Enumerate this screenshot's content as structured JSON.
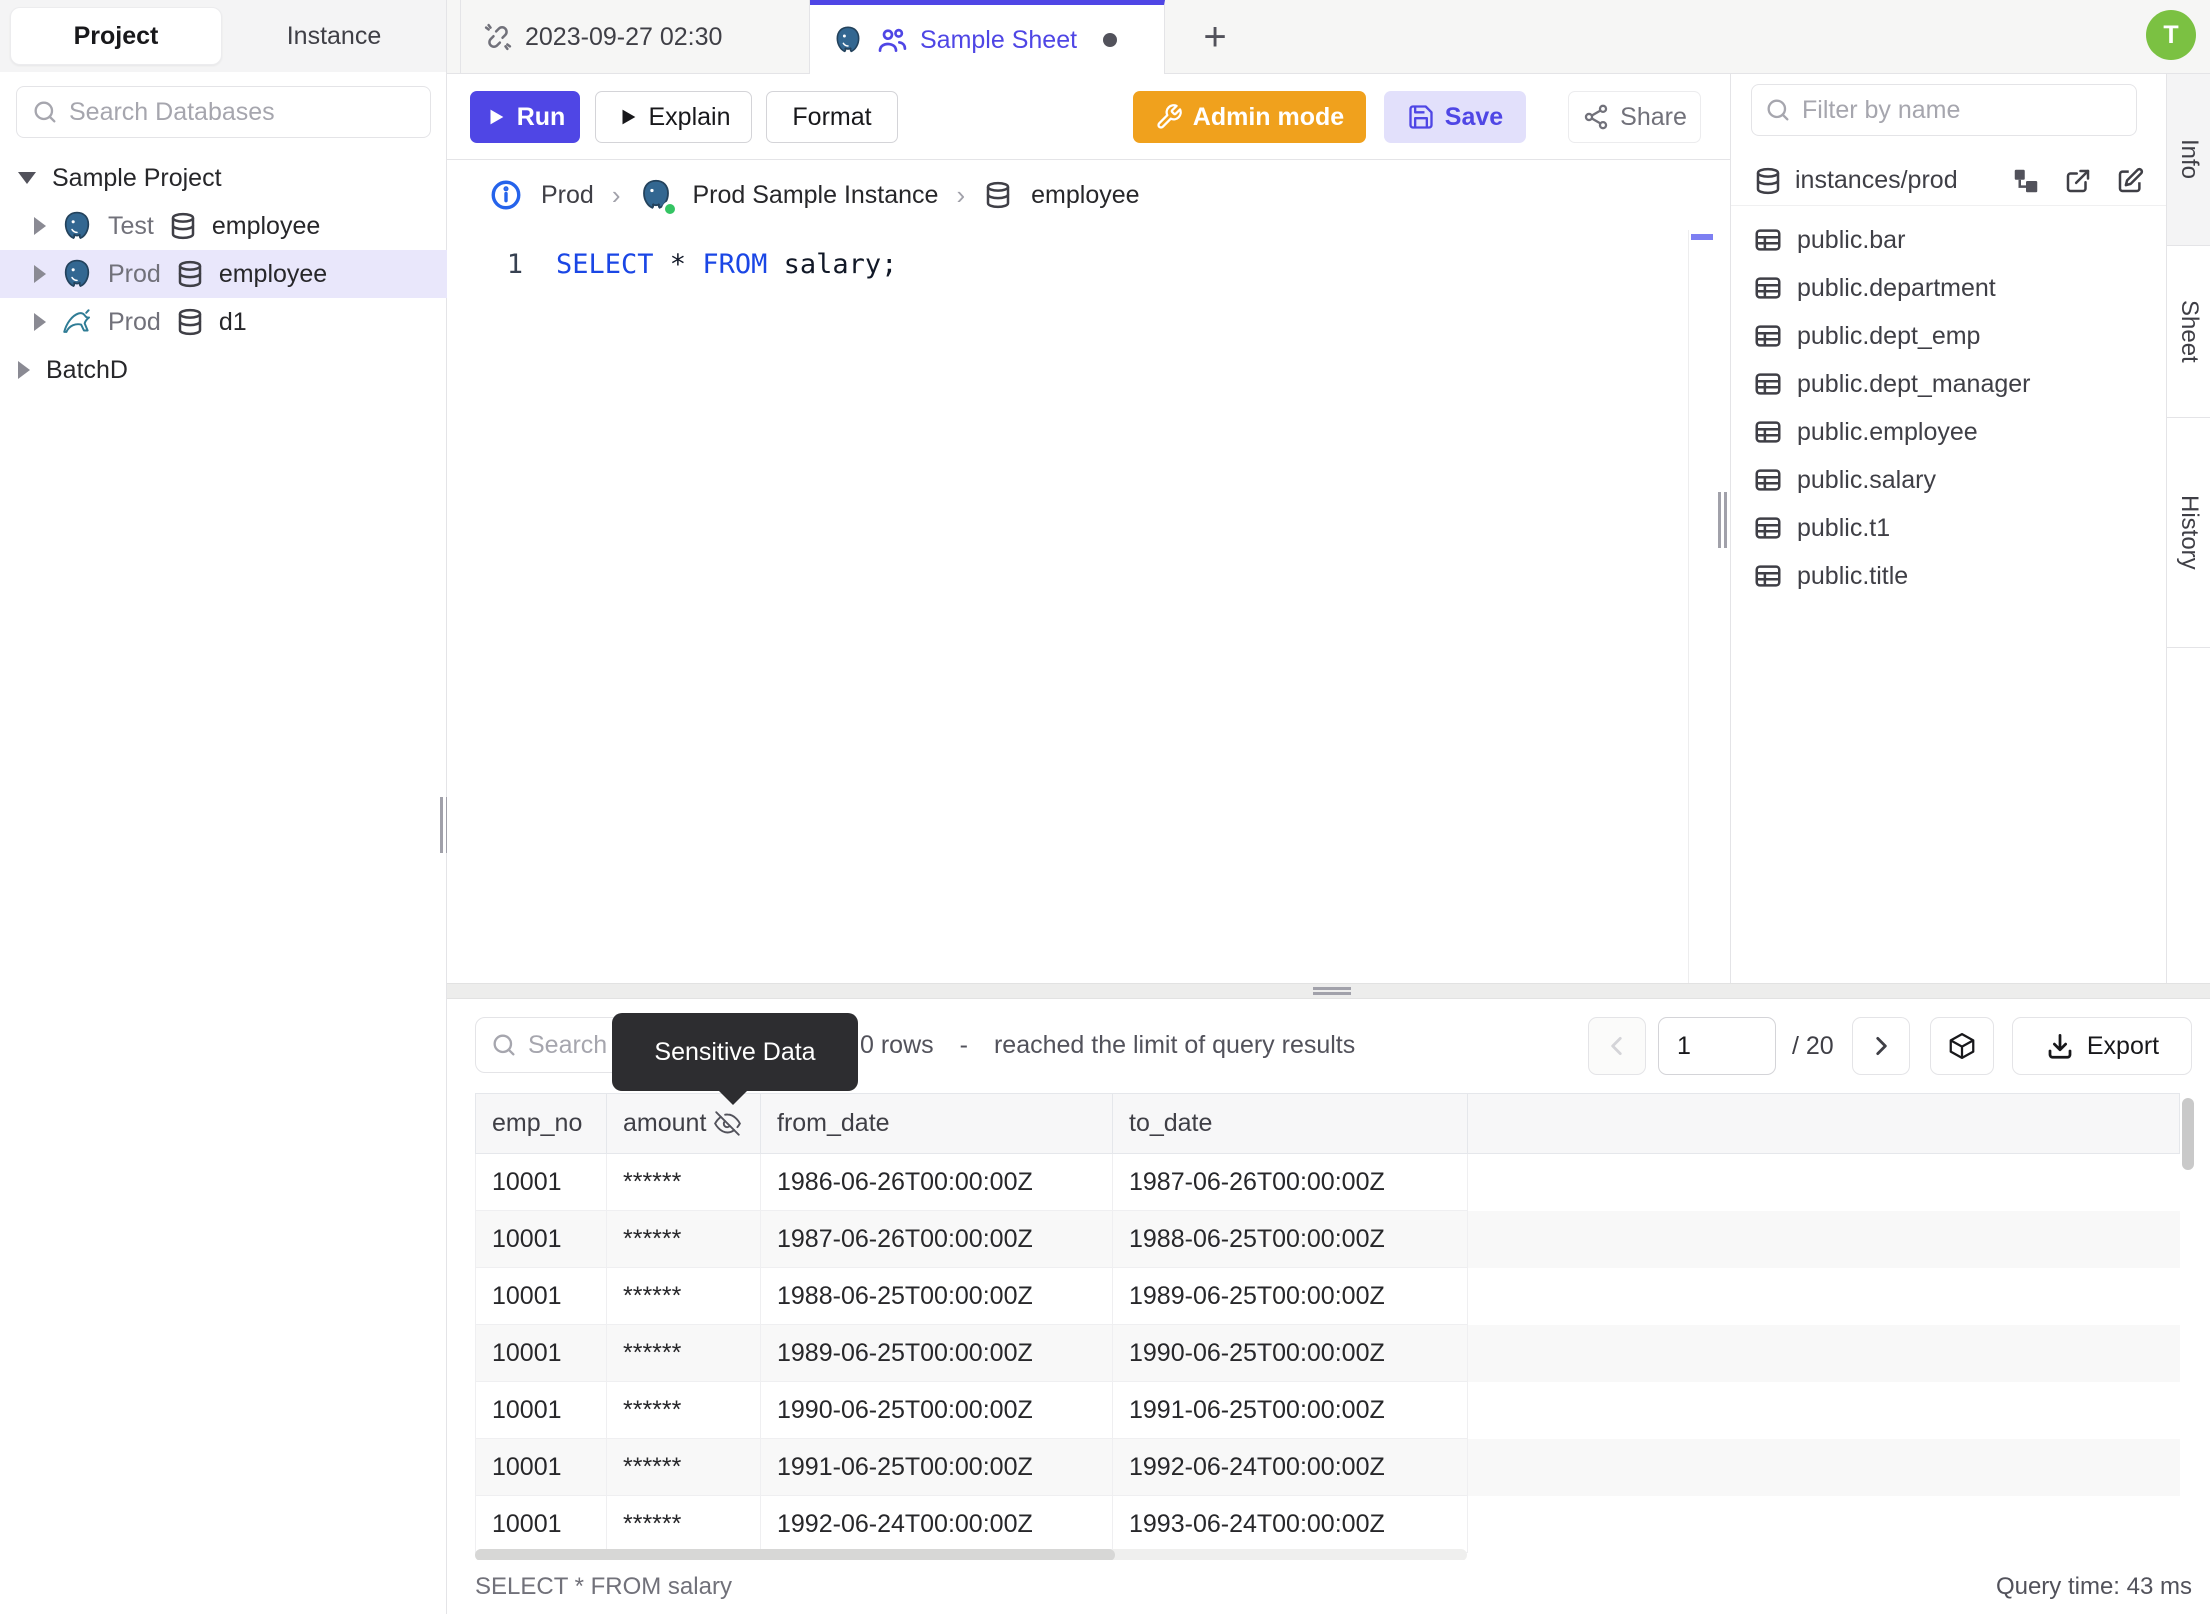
{
  "sidebar": {
    "tabs": {
      "project": "Project",
      "instance": "Instance"
    },
    "search_placeholder": "Search Databases",
    "tree": {
      "project1": "Sample Project",
      "item1": {
        "env": "Test",
        "db": "employee",
        "engine": "postgres"
      },
      "item2": {
        "env": "Prod",
        "db": "employee",
        "engine": "postgres",
        "selected": true
      },
      "item3": {
        "env": "Prod",
        "db": "d1",
        "engine": "mysql"
      },
      "project2": "BatchD"
    }
  },
  "tabbar": {
    "timestamp_tab": "2023-09-27 02:30",
    "sheet_tab": "Sample Sheet",
    "new_tab": "+",
    "avatar_initial": "T"
  },
  "toolbar": {
    "run": "Run",
    "explain": "Explain",
    "format": "Format",
    "admin": "Admin mode",
    "save": "Save",
    "share": "Share"
  },
  "breadcrumb": {
    "env": "Prod",
    "instance": "Prod Sample Instance",
    "db": "employee"
  },
  "editor": {
    "line_no": "1",
    "kw1": "SELECT",
    "op": " * ",
    "kw2": "FROM",
    "tail": " salary;"
  },
  "right_panel": {
    "filter_placeholder": "Filter by name",
    "group": "instances/prod",
    "tables": [
      "public.bar",
      "public.department",
      "public.dept_emp",
      "public.dept_manager",
      "public.employee",
      "public.salary",
      "public.t1",
      "public.title"
    ]
  },
  "right_strip": {
    "tabs": [
      "Info",
      "Sheet",
      "History"
    ]
  },
  "results": {
    "search_placeholder": "Search",
    "tooltip": "Sensitive Data",
    "rows_text_visible": "0 rows",
    "dash": "-",
    "limit_text": "reached the limit of query results",
    "pager": {
      "page": "1",
      "total": "/ 20"
    },
    "export_label": "Export",
    "columns": [
      "emp_no",
      "amount",
      "from_date",
      "to_date"
    ],
    "rows": [
      [
        "10001",
        "******",
        "1986-06-26T00:00:00Z",
        "1987-06-26T00:00:00Z"
      ],
      [
        "10001",
        "******",
        "1987-06-26T00:00:00Z",
        "1988-06-25T00:00:00Z"
      ],
      [
        "10001",
        "******",
        "1988-06-25T00:00:00Z",
        "1989-06-25T00:00:00Z"
      ],
      [
        "10001",
        "******",
        "1989-06-25T00:00:00Z",
        "1990-06-25T00:00:00Z"
      ],
      [
        "10001",
        "******",
        "1990-06-25T00:00:00Z",
        "1991-06-25T00:00:00Z"
      ],
      [
        "10001",
        "******",
        "1991-06-25T00:00:00Z",
        "1992-06-24T00:00:00Z"
      ],
      [
        "10001",
        "******",
        "1992-06-24T00:00:00Z",
        "1993-06-24T00:00:00Z"
      ]
    ],
    "status_left": "SELECT * FROM salary",
    "status_right": "Query time: 43 ms"
  },
  "colors": {
    "accent_indigo": "#4f46e5",
    "admin_orange": "#f0a11d",
    "save_bg": "#e2e0fb",
    "avatar_green": "#7bc142",
    "keyword_blue": "#1a46e5",
    "tooltip_bg": "#2d2d30",
    "selected_tree_bg": "#e9e7fb",
    "status_green": "#34c463"
  }
}
